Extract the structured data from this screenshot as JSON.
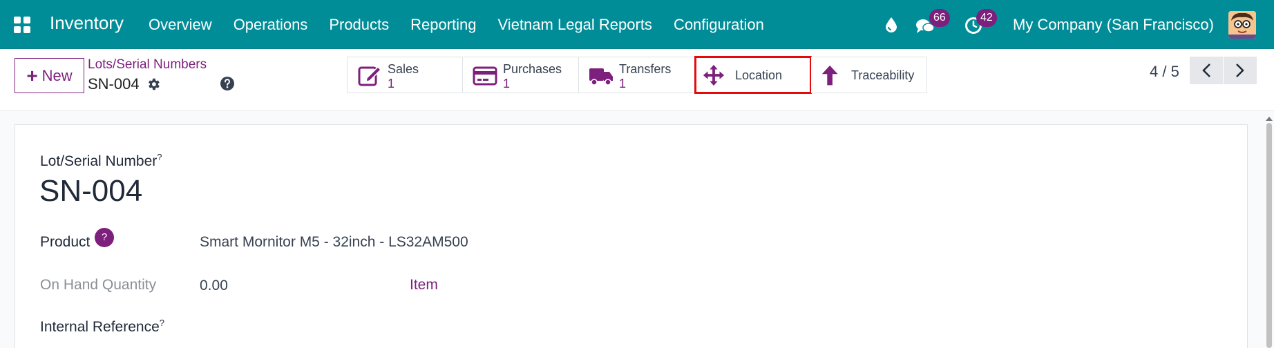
{
  "navbar": {
    "app_title": "Inventory",
    "menu": [
      "Overview",
      "Operations",
      "Products",
      "Reporting",
      "Vietnam Legal Reports",
      "Configuration"
    ],
    "messages_count": "66",
    "activities_count": "42",
    "company": "My Company (San Francisco)",
    "icons": [
      "apps-grid-icon",
      "droplet-icon",
      "chat-icon",
      "clock-icon",
      "avatar"
    ]
  },
  "control": {
    "new_label": "New",
    "breadcrumb": "Lots/Serial Numbers",
    "record_name": "SN-004",
    "stat_buttons": [
      {
        "label": "Sales",
        "value": "1",
        "icon": "edit-icon"
      },
      {
        "label": "Purchases",
        "value": "1",
        "icon": "credit-card-icon"
      },
      {
        "label": "Transfers",
        "value": "1",
        "icon": "truck-icon"
      },
      {
        "label": "Location",
        "value": "",
        "icon": "move-arrows-icon"
      },
      {
        "label": "Traceability",
        "value": "",
        "icon": "arrow-up-icon"
      }
    ],
    "pager": "4 / 5"
  },
  "form": {
    "lot_label": "Lot/Serial Number",
    "lot_help": "?",
    "lot_value": "SN-004",
    "product_label": "Product",
    "product_help": "?",
    "product_value": "Smart Mornitor M5 - 32inch - LS32AM500",
    "qty_label": "On Hand Quantity",
    "qty_value": "0.00",
    "uom_value": "Item",
    "ref_label": "Internal Reference",
    "ref_help": "?"
  },
  "colors": {
    "navbar": "#018d98",
    "accent": "#7d1f7c",
    "highlight_border": "#e30b0b"
  }
}
